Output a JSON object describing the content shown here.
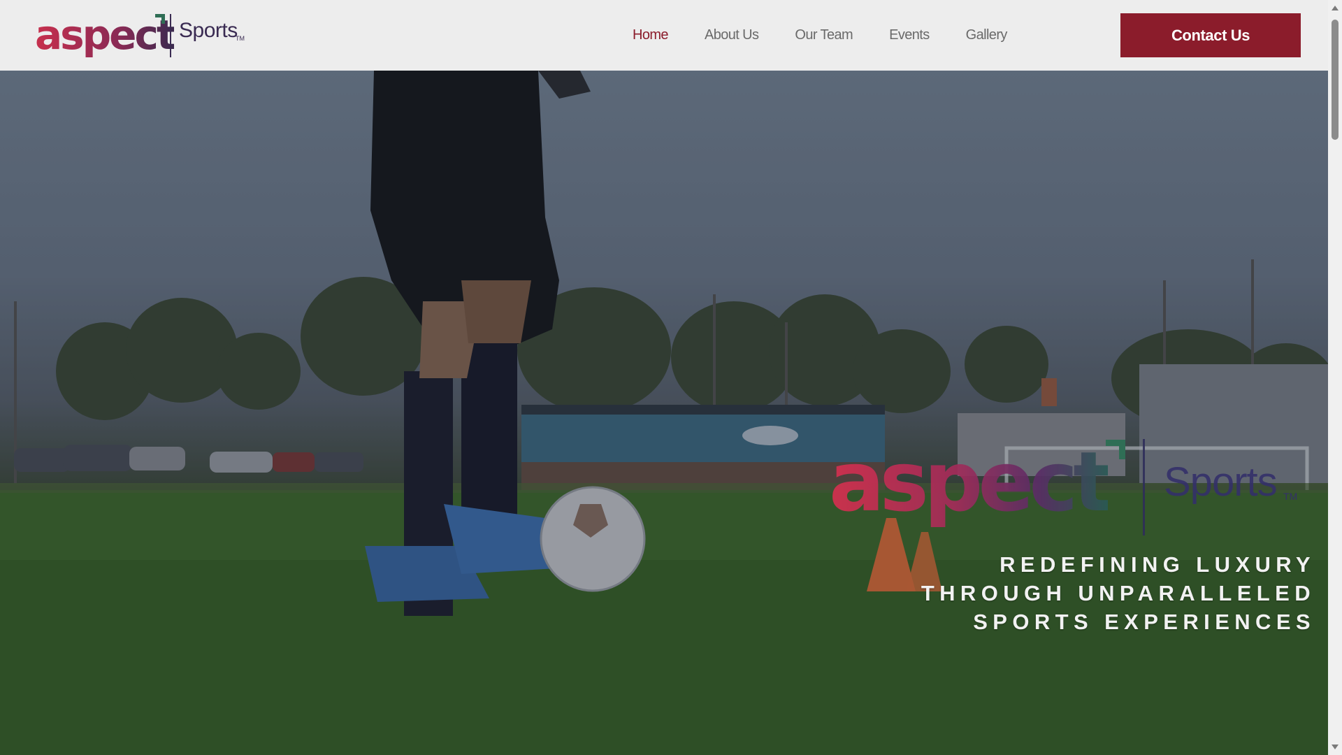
{
  "header": {
    "logo": {
      "wordmark": "aspect",
      "sub": "Sports",
      "tm": "TM"
    },
    "nav": [
      {
        "label": "Home",
        "active": true
      },
      {
        "label": "About Us",
        "active": false
      },
      {
        "label": "Our Team",
        "active": false
      },
      {
        "label": "Events",
        "active": false
      },
      {
        "label": "Gallery",
        "active": false
      }
    ],
    "contact_label": "Contact Us"
  },
  "hero": {
    "logo": {
      "wordmark": "aspect",
      "sub": "Sports",
      "tm": "TM"
    },
    "tagline": [
      "REDEFINING LUXURY",
      "THROUGH UNPARALLELED",
      "SPORTS EXPERIENCES"
    ]
  },
  "colors": {
    "brand_red": "#8b1c2b",
    "logo_purple": "#3a2b52",
    "logo_green": "#2f6e55",
    "nav_text": "#6a6a6a",
    "header_bg": "#ededed"
  }
}
